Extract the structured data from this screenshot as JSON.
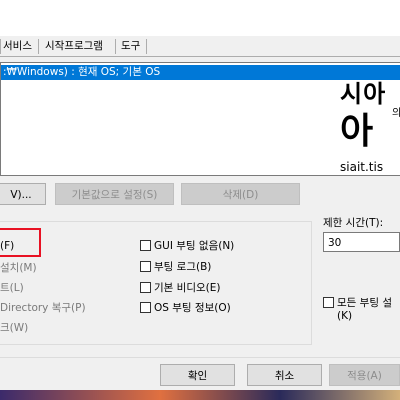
{
  "tabs": [
    "서비스",
    "시작프로그램",
    "도구"
  ],
  "boot_list": {
    "selected_entry": ":₩Windows) : 현재 OS; 기본 OS"
  },
  "logo": {
    "line1": "시아",
    "line1_small": "의",
    "line2": "아",
    "url": "siait.tis"
  },
  "buttons": {
    "advanced": "V)...",
    "set_default": "기본값으로 설정(S)",
    "delete": "삭제(D)"
  },
  "boot_options": {
    "left": [
      "(F)",
      "설치(M)",
      "트(L)",
      "Directory 복구(P)",
      "크(W)"
    ],
    "right": [
      "GUI 부팅 없음(N)",
      "부팅 로그(B)",
      "기본 비디오(E)",
      "OS 부팅 정보(O)"
    ]
  },
  "timeout": {
    "label": "제한 시간(T):",
    "value": "30"
  },
  "make_permanent": {
    "label": "모든 부팅 설",
    "label2": "(K)"
  },
  "footer": {
    "ok": "확인",
    "cancel": "취소",
    "apply": "적용(A)"
  }
}
